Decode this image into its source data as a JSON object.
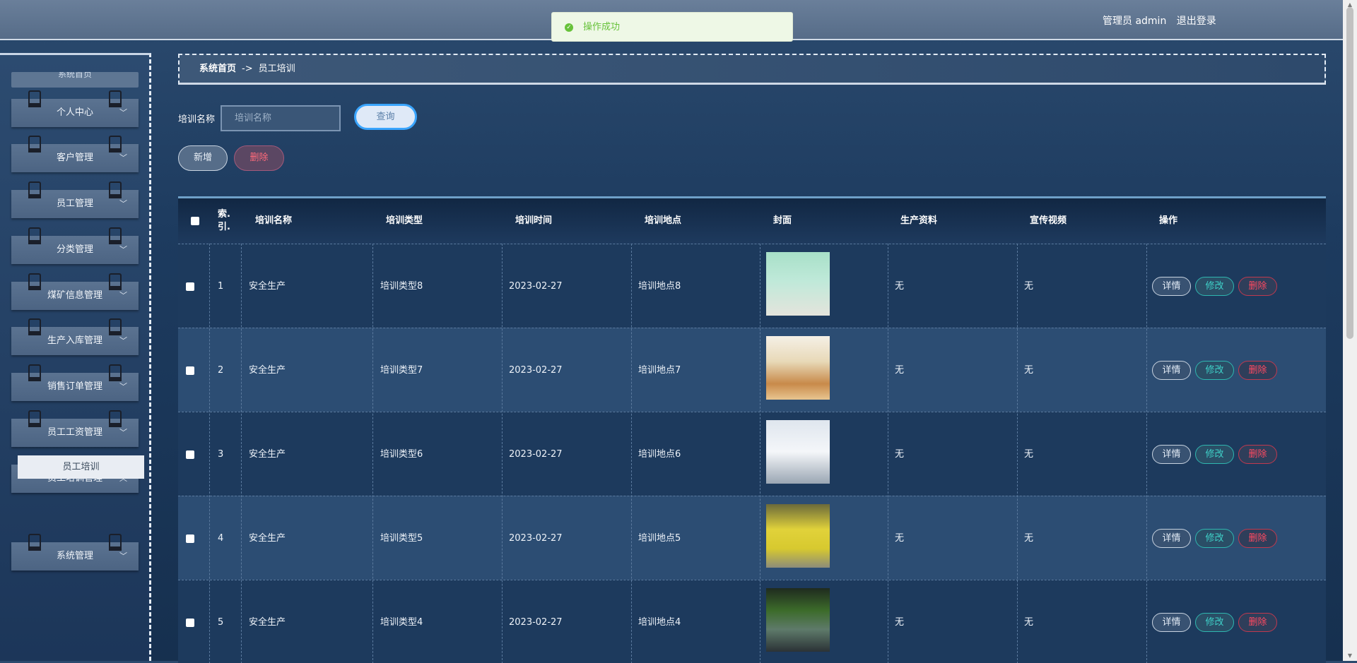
{
  "header": {
    "user_label": "管理员 admin",
    "logout_label": "退出登录"
  },
  "toast": {
    "message": "操作成功"
  },
  "sidebar": {
    "top_stub": "系统首页",
    "items": [
      {
        "label": "个人中心"
      },
      {
        "label": "客户管理"
      },
      {
        "label": "员工管理"
      },
      {
        "label": "分类管理"
      },
      {
        "label": "煤矿信息管理"
      },
      {
        "label": "生产入库管理"
      },
      {
        "label": "销售订单管理"
      },
      {
        "label": "员工工资管理"
      },
      {
        "label": "员工培训管理"
      },
      {
        "label": "系统管理"
      }
    ],
    "submenu": "员工培训"
  },
  "breadcrumb": {
    "home": "系统首页",
    "sep": "->",
    "current": "员工培训"
  },
  "search": {
    "label": "培训名称",
    "placeholder": "培训名称",
    "query_label": "查询"
  },
  "actions": {
    "add_label": "新增",
    "delete_label": "删除"
  },
  "table": {
    "headers": [
      "索引",
      "培训名称",
      "培训类型",
      "培训时间",
      "培训地点",
      "封面",
      "生产资料",
      "宣传视频",
      "操作"
    ],
    "index_header_top": "索.",
    "index_header_bottom": "引.",
    "rows": [
      {
        "index": "1",
        "name": "安全生产",
        "type": "培训类型8",
        "time": "2023-02-27",
        "place": "培训地点8",
        "material": "无",
        "video": "无"
      },
      {
        "index": "2",
        "name": "安全生产",
        "type": "培训类型7",
        "time": "2023-02-27",
        "place": "培训地点7",
        "material": "无",
        "video": "无"
      },
      {
        "index": "3",
        "name": "安全生产",
        "type": "培训类型6",
        "time": "2023-02-27",
        "place": "培训地点6",
        "material": "无",
        "video": "无"
      },
      {
        "index": "4",
        "name": "安全生产",
        "type": "培训类型5",
        "time": "2023-02-27",
        "place": "培训地点5",
        "material": "无",
        "video": "无"
      },
      {
        "index": "5",
        "name": "安全生产",
        "type": "培训类型4",
        "time": "2023-02-27",
        "place": "培训地点4",
        "material": "无",
        "video": "无"
      }
    ],
    "row_actions": {
      "detail": "详情",
      "edit": "修改",
      "remove": "删除"
    }
  }
}
